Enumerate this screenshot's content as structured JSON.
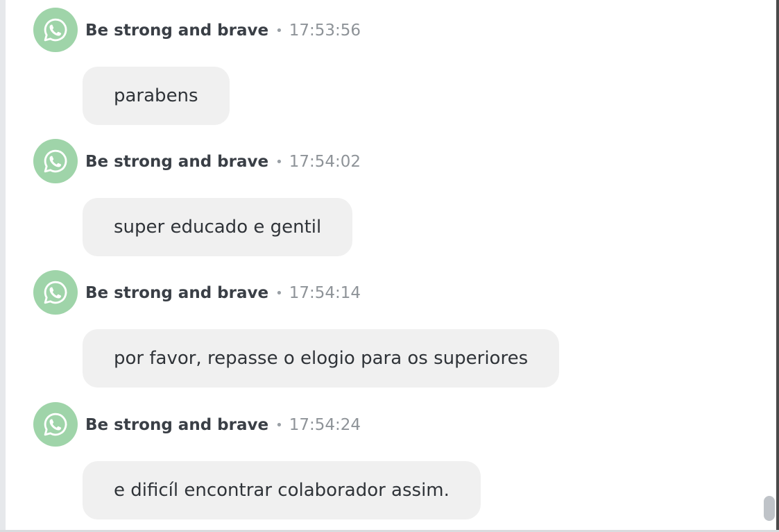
{
  "colors": {
    "avatar_bg": "#9fd4a9",
    "bubble_bg": "#f0f0f0",
    "sender_text": "#3a3f46",
    "time_text": "#8e9398"
  },
  "messages": [
    {
      "avatar_icon": "whatsapp-icon",
      "sender": "Be strong and brave",
      "separator": "•",
      "time": "17:53:56",
      "text": "parabens"
    },
    {
      "avatar_icon": "whatsapp-icon",
      "sender": "Be strong and brave",
      "separator": "•",
      "time": "17:54:02",
      "text": "super educado e gentil"
    },
    {
      "avatar_icon": "whatsapp-icon",
      "sender": "Be strong and brave",
      "separator": "•",
      "time": "17:54:14",
      "text": "por favor, repasse o elogio para os superiores"
    },
    {
      "avatar_icon": "whatsapp-icon",
      "sender": "Be strong and brave",
      "separator": "•",
      "time": "17:54:24",
      "text": "e dificíl encontrar colaborador assim."
    }
  ]
}
